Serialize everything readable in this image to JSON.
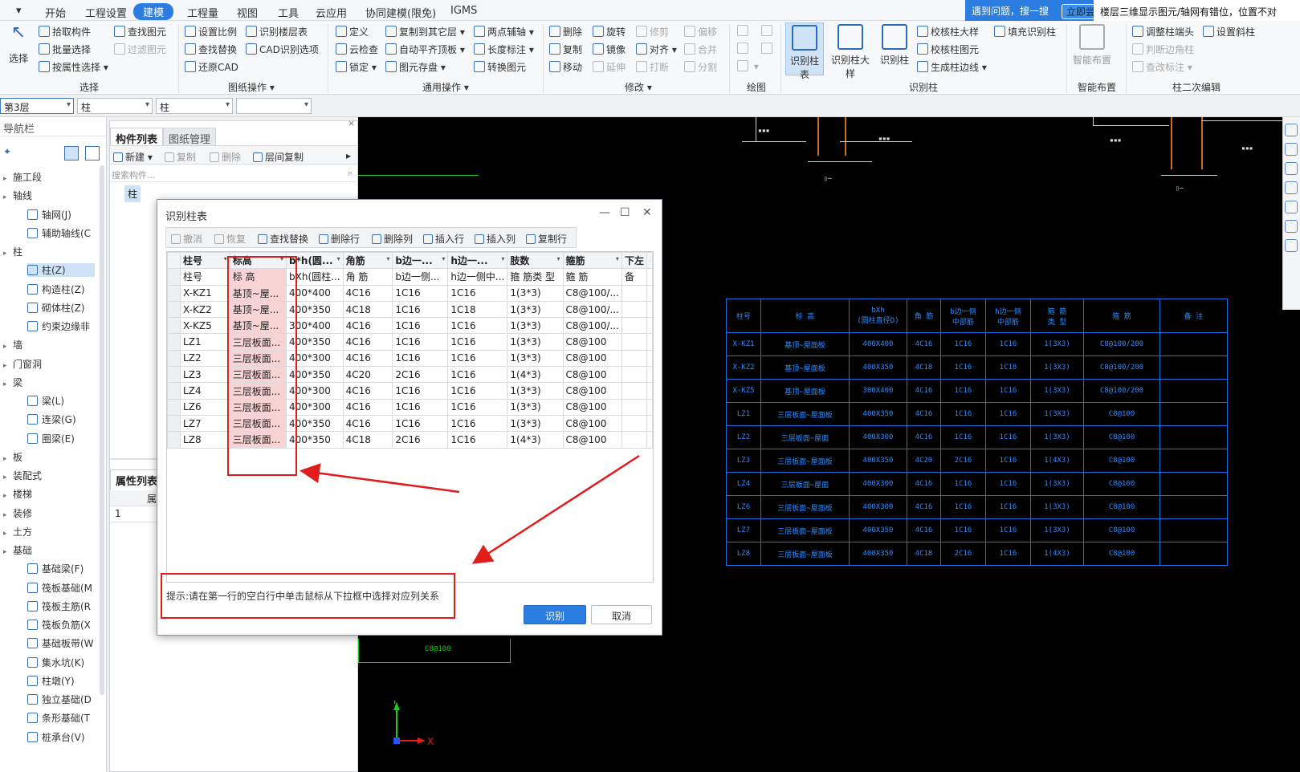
{
  "menu": {
    "items": [
      "开始",
      "工程设置",
      "建模",
      "工程量",
      "视图",
      "工具",
      "云应用",
      "协同建模(限免)",
      "IGMS"
    ],
    "active": "建模",
    "help_text": "遇到问题，搜一搜",
    "try_now": "立即尝试",
    "notice": "楼层三维显示图元/轴网有错位，位置不对"
  },
  "ribbon": {
    "select_group": {
      "big": "选择",
      "items": [
        "拾取构件",
        "批量选择",
        "按属性选择",
        "查找图元",
        "过滤图元"
      ],
      "label": "选择"
    },
    "drawing_ops": {
      "items": [
        "设置比例",
        "识别楼层表",
        "查找替换",
        "CAD识别选项",
        "还原CAD"
      ],
      "label": "图纸操作"
    },
    "common_ops": {
      "items": [
        "定义",
        "复制到其它层",
        "两点辅轴",
        "云检查",
        "自动平齐顶板",
        "长度标注",
        "锁定",
        "图元存盘",
        "转换图元"
      ],
      "label": "通用操作"
    },
    "modify": {
      "items": [
        "删除",
        "旋转",
        "修剪",
        "偏移",
        "复制",
        "镜像",
        "对齐",
        "合并",
        "移动",
        "延伸",
        "打断",
        "分割"
      ],
      "label": "修改"
    },
    "draw": {
      "label": "绘图"
    },
    "recognize_col": {
      "big": [
        "识别柱表",
        "识别柱大样",
        "识别柱"
      ],
      "items": [
        "校核柱大样",
        "填充识别柱",
        "校核柱图元",
        "生成柱边线"
      ],
      "label": "识别柱"
    },
    "smart": {
      "big": "智能布置",
      "label": "智能布置"
    },
    "col_edit": {
      "items": [
        "调整柱端头",
        "设置斜柱",
        "判断边角柱",
        "查改标注"
      ],
      "label": "柱二次编辑"
    }
  },
  "floorbar": {
    "floor": "第3层",
    "type1": "柱",
    "type2": "柱",
    "type3": ""
  },
  "nav": {
    "title": "导航栏",
    "rows": [
      {
        "kind": "cat",
        "label": "施工段"
      },
      {
        "kind": "cat",
        "label": "轴线"
      },
      {
        "kind": "item",
        "label": "轴网(J)"
      },
      {
        "kind": "item",
        "label": "辅助轴线(C"
      },
      {
        "kind": "cat",
        "label": "柱"
      },
      {
        "kind": "item",
        "label": "柱(Z)",
        "selected": true
      },
      {
        "kind": "item",
        "label": "构造柱(Z)"
      },
      {
        "kind": "item",
        "label": "砌体柱(Z)"
      },
      {
        "kind": "item",
        "label": "约束边缘非"
      },
      {
        "kind": "cat",
        "label": "墙"
      },
      {
        "kind": "cat",
        "label": "门窗洞"
      },
      {
        "kind": "cat",
        "label": "梁"
      },
      {
        "kind": "item",
        "label": "梁(L)"
      },
      {
        "kind": "item",
        "label": "连梁(G)"
      },
      {
        "kind": "item",
        "label": "圈梁(E)"
      },
      {
        "kind": "cat",
        "label": "板"
      },
      {
        "kind": "cat",
        "label": "装配式"
      },
      {
        "kind": "cat",
        "label": "楼梯"
      },
      {
        "kind": "cat",
        "label": "装修"
      },
      {
        "kind": "cat",
        "label": "土方"
      },
      {
        "kind": "cat",
        "label": "基础"
      },
      {
        "kind": "item",
        "label": "基础梁(F)"
      },
      {
        "kind": "item",
        "label": "筏板基础(M"
      },
      {
        "kind": "item",
        "label": "筏板主筋(R"
      },
      {
        "kind": "item",
        "label": "筏板负筋(X"
      },
      {
        "kind": "item",
        "label": "基础板带(W"
      },
      {
        "kind": "item",
        "label": "集水坑(K)"
      },
      {
        "kind": "item",
        "label": "柱墩(Y)"
      },
      {
        "kind": "item",
        "label": "独立基础(D"
      },
      {
        "kind": "item",
        "label": "条形基础(T"
      },
      {
        "kind": "item",
        "label": "桩承台(V)"
      }
    ]
  },
  "comp": {
    "tabs": [
      "构件列表",
      "图纸管理"
    ],
    "new": "新建",
    "copy": "复制",
    "delete": "删除",
    "floor_copy": "层间复制",
    "search_placeholder": "搜索构件...",
    "tree_item": "柱",
    "props_tab": "属性列表",
    "props_col": "属",
    "props_row": "1"
  },
  "dialog": {
    "title": "识别柱表",
    "toolbar": [
      "撤消",
      "恢复",
      "查找替换",
      "删除行",
      "删除列",
      "插入行",
      "插入列",
      "复制行"
    ],
    "headers": [
      "柱号",
      "标高",
      "b*h(圆...",
      "角筋",
      "b边一...",
      "h边一...",
      "肢数",
      "箍筋",
      "下左"
    ],
    "subheaders": [
      "柱号",
      "标 高",
      "bXh(圆柱...",
      "角 筋",
      "b边一侧...",
      "h边一侧中...",
      "箍 筋类 型",
      "箍 筋",
      "备"
    ],
    "rows": [
      [
        "X-KZ1",
        "基顶~屋...",
        "400*400",
        "4C16",
        "1C16",
        "1C16",
        "1(3*3)",
        "C8@100/...",
        ""
      ],
      [
        "X-KZ2",
        "基顶~屋...",
        "400*350",
        "4C18",
        "1C16",
        "1C18",
        "1(3*3)",
        "C8@100/...",
        ""
      ],
      [
        "X-KZ5",
        "基顶~屋...",
        "300*400",
        "4C16",
        "1C16",
        "1C16",
        "1(3*3)",
        "C8@100/...",
        ""
      ],
      [
        "LZ1",
        "三层板面...",
        "400*350",
        "4C16",
        "1C16",
        "1C16",
        "1(3*3)",
        "C8@100",
        ""
      ],
      [
        "LZ2",
        "三层板面...",
        "400*300",
        "4C16",
        "1C16",
        "1C16",
        "1(3*3)",
        "C8@100",
        ""
      ],
      [
        "LZ3",
        "三层板面...",
        "400*350",
        "4C20",
        "2C16",
        "1C16",
        "1(4*3)",
        "C8@100",
        ""
      ],
      [
        "LZ4",
        "三层板面...",
        "400*300",
        "4C16",
        "1C16",
        "1C16",
        "1(3*3)",
        "C8@100",
        ""
      ],
      [
        "LZ6",
        "三层板面...",
        "400*300",
        "4C16",
        "1C16",
        "1C16",
        "1(3*3)",
        "C8@100",
        ""
      ],
      [
        "LZ7",
        "三层板面...",
        "400*350",
        "4C16",
        "1C16",
        "1C16",
        "1(3*3)",
        "C8@100",
        ""
      ],
      [
        "LZ8",
        "三层板面...",
        "400*350",
        "4C18",
        "2C16",
        "1C16",
        "1(4*3)",
        "C8@100",
        ""
      ]
    ],
    "hint": "提示:请在第一行的空白行中单击鼠标从下拉框中选择对应列关系",
    "ok": "识别",
    "cancel": "取消"
  },
  "cad": {
    "table_header": [
      "柱号",
      "标 高",
      "bXh\n(圆柱直径D)",
      "角 筋",
      "b边一侧\n中部筋",
      "h边一侧\n中部筋",
      "箍 筋\n类 型",
      "箍 筋",
      "备 注"
    ],
    "table_rows": [
      [
        "X-KZ1",
        "基顶~屋面板",
        "400X400",
        "4C16",
        "1C16",
        "1C16",
        "1(3X3)",
        "C8@100/200",
        ""
      ],
      [
        "X-KZ2",
        "基顶~屋面板",
        "400X350",
        "4C18",
        "1C16",
        "1C18",
        "1(3X3)",
        "C8@100/200",
        ""
      ],
      [
        "X-KZ5",
        "基顶~屋面板",
        "300X400",
        "4C16",
        "1C16",
        "1C16",
        "1(3X3)",
        "C8@100/200",
        ""
      ],
      [
        "LZ1",
        "三层板面~屋面板",
        "400X350",
        "4C16",
        "1C16",
        "1C16",
        "1(3X3)",
        "C8@100",
        ""
      ],
      [
        "LZ2",
        "三层板面~屋面",
        "400X300",
        "4C16",
        "1C16",
        "1C16",
        "1(3X3)",
        "C8@100",
        ""
      ],
      [
        "LZ3",
        "三层板面~屋面板",
        "400X350",
        "4C20",
        "2C16",
        "1C16",
        "1(4X3)",
        "C8@100",
        ""
      ],
      [
        "LZ4",
        "三层板面~屋面",
        "400X300",
        "4C16",
        "1C16",
        "1C16",
        "1(3X3)",
        "C8@100",
        ""
      ],
      [
        "LZ6",
        "三层板面~屋面板",
        "400X300",
        "4C16",
        "1C16",
        "1C16",
        "1(3X3)",
        "C8@100",
        ""
      ],
      [
        "LZ7",
        "三层板面~屋面板",
        "400X350",
        "4C16",
        "1C16",
        "1C16",
        "1(3X3)",
        "C8@100",
        ""
      ],
      [
        "LZ8",
        "三层板面~屋面板",
        "400X350",
        "4C18",
        "2C16",
        "1C16",
        "1(4X3)",
        "C8@100",
        ""
      ]
    ],
    "bottom_label": "C8@100",
    "axis_x": "X",
    "axis_y": "Y"
  },
  "colors": {
    "accent": "#2b7de1",
    "annotation": "#e21b1b",
    "cad_blue": "#1a6fe0",
    "highlight": "#f8d3d3"
  }
}
